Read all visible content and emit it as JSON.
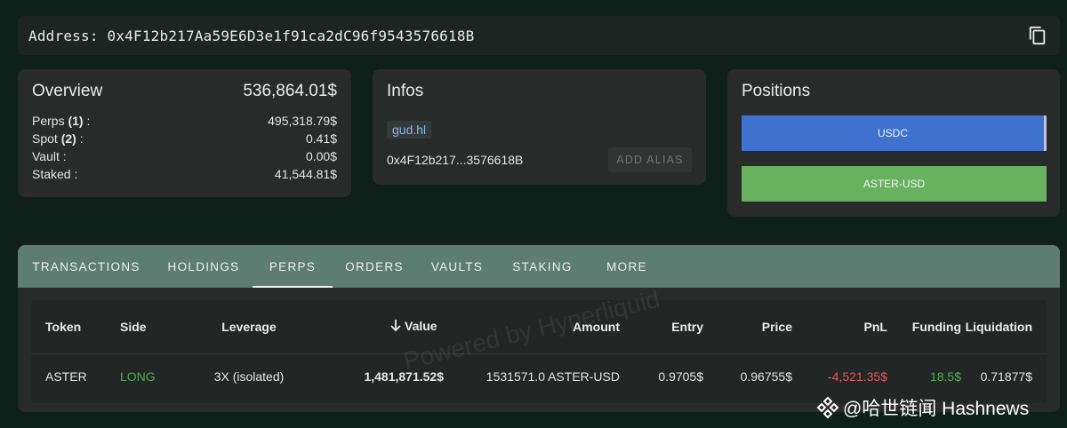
{
  "address": {
    "label": "Address:",
    "value": "0x4F12b217Aa59E6D3e1f91ca2dC96f9543576618B",
    "copy_icon": "copy-icon"
  },
  "overview": {
    "title": "Overview",
    "total": "536,864.01$",
    "rows": [
      {
        "label": "Perps",
        "count": "(1)",
        "suffix": ":",
        "value": "495,318.79$"
      },
      {
        "label": "Spot",
        "count": "(2)",
        "suffix": ":",
        "value": "0.41$"
      },
      {
        "label": "Vault",
        "count": "",
        "suffix": ":",
        "value": "0.00$"
      },
      {
        "label": "Staked",
        "count": "",
        "suffix": ":",
        "value": "41,544.81$"
      }
    ]
  },
  "infos": {
    "title": "Infos",
    "alias": "gud.hl",
    "short_address": "0x4F12b217...3576618B",
    "add_alias_label": "ADD ALIAS"
  },
  "positions": {
    "title": "Positions",
    "items": [
      {
        "label": "USDC",
        "color": "#3f72cf"
      },
      {
        "label": "ASTER-USD",
        "color": "#67b15f"
      }
    ]
  },
  "tabs": [
    {
      "label": "TRANSACTIONS",
      "active": false
    },
    {
      "label": "HOLDINGS",
      "active": false
    },
    {
      "label": "PERPS",
      "active": true
    },
    {
      "label": "ORDERS",
      "active": false
    },
    {
      "label": "VAULTS",
      "active": false
    },
    {
      "label": "STAKING",
      "active": false
    },
    {
      "label": "MORE",
      "active": false
    }
  ],
  "table": {
    "sort_icon": "arrow-down-icon",
    "headers": [
      "Token",
      "Side",
      "Leverage",
      "Value",
      "Amount",
      "Entry",
      "Price",
      "PnL",
      "Funding",
      "Liquidation"
    ],
    "rows": [
      {
        "token": "ASTER",
        "side": "LONG",
        "leverage": "3X (isolated)",
        "value": "1,481,871.52$",
        "amount": "1531571.0 ASTER-USD",
        "entry": "0.9705$",
        "price": "0.96755$",
        "pnl": "-4,521.35$",
        "funding": "18.5$",
        "liquidation": "0.71877$"
      }
    ]
  },
  "watermark": "Powered by Hyperliquid",
  "brand": {
    "text": "@哈世链闻 Hashnews",
    "icon": "diamond-logo-icon"
  },
  "colors": {
    "background": "#0f1f1a",
    "card": "#272b2a",
    "tab_bar": "#5d7d72",
    "long": "#4cae4f",
    "negative": "#e25b5b"
  }
}
